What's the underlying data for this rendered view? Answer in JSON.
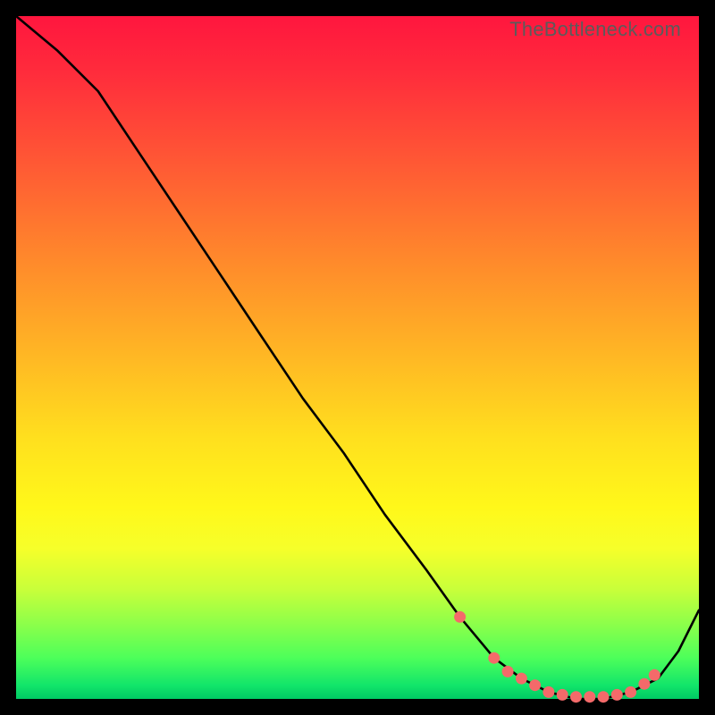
{
  "watermark": "TheBottleneck.com",
  "chart_data": {
    "type": "line",
    "title": "",
    "xlabel": "",
    "ylabel": "",
    "xlim": [
      0,
      100
    ],
    "ylim": [
      0,
      100
    ],
    "grid": false,
    "legend": false,
    "series": [
      {
        "name": "curve",
        "color": "#000000",
        "x": [
          0,
          6,
          12,
          18,
          24,
          30,
          36,
          42,
          48,
          54,
          60,
          65,
          70,
          74,
          78,
          82,
          86,
          90,
          94,
          97,
          100
        ],
        "y": [
          100,
          95,
          89,
          80,
          71,
          62,
          53,
          44,
          36,
          27,
          19,
          12,
          6,
          3,
          1,
          0,
          0,
          1,
          3,
          7,
          13
        ]
      },
      {
        "name": "markers",
        "color": "#f46a6a",
        "type": "scatter",
        "x": [
          65,
          70,
          72,
          74,
          76,
          78,
          80,
          82,
          84,
          86,
          88,
          90,
          92,
          93.5
        ],
        "y": [
          12,
          6,
          4,
          3,
          2,
          1,
          0.6,
          0.3,
          0.3,
          0.3,
          0.6,
          1,
          2.2,
          3.5
        ]
      }
    ]
  },
  "colors": {
    "marker": "#f46a6a",
    "line": "#000000",
    "watermark": "#5b5b5b"
  }
}
